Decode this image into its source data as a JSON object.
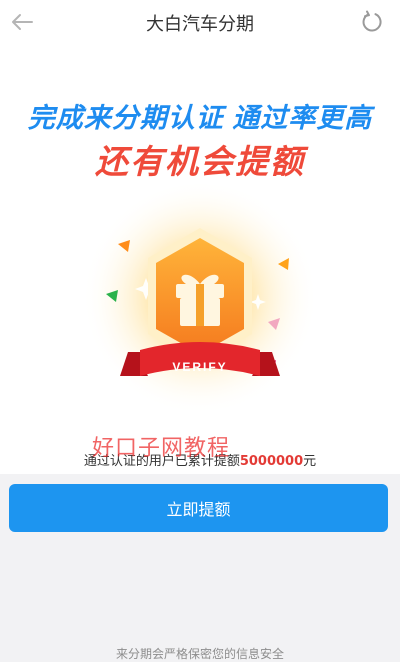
{
  "header": {
    "title": "大白汽车分期"
  },
  "promo": {
    "line1": "完成来分期认证 通过率更高",
    "line2": "还有机会提额",
    "badge_label": "VERIFY"
  },
  "stat": {
    "prefix": "通过认证的用户已累计提额",
    "amount": "5000000",
    "suffix": "元"
  },
  "watermark": "好口子网教程",
  "actions": {
    "primary_label": "立即提额"
  },
  "footer": {
    "note": "来分期会严格保密您的信息安全"
  },
  "colors": {
    "accent_blue": "#1d95f0",
    "headline_blue": "#1e8cf0",
    "headline_red": "#ef4a3a",
    "amount_red": "#e33a35",
    "page_bg": "#f2f2f4"
  },
  "icons": {
    "back": "arrow-left-icon",
    "refresh": "refresh-icon",
    "gift": "gift-icon"
  }
}
